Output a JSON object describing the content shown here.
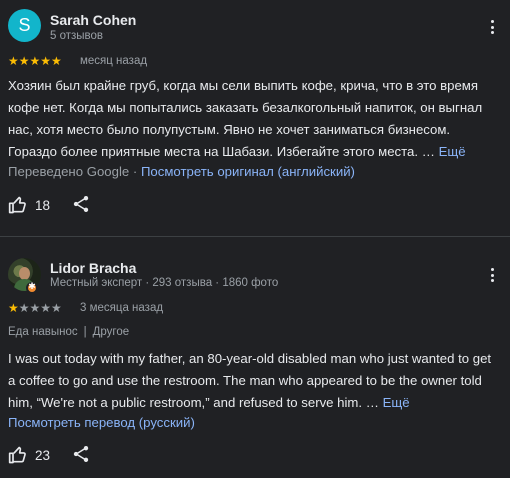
{
  "reviews": [
    {
      "avatar_letter": "S",
      "name": "Sarah Cohen",
      "meta": "5 отзывов",
      "rating": 5,
      "stars_filled": "★★★★★",
      "stars_empty": "",
      "when": "месяц назад",
      "text": "Хозяин был крайне груб, когда мы сели выпить кофе, крича, что в это время кофе нет. Когда мы попытались заказать безалкогольный напиток, он выгнал нас, хотя место было полупустым. Явно не хочет заниматься бизнесом. Гораздо более приятные места на Шабази. Избегайте этого места. …",
      "more": "Ещё",
      "translated_prefix": "Переведено Google ·",
      "translated_link": "Посмотреть оригинал (английский)",
      "likes": "18",
      "icons": {
        "like": "thumbs-up-icon",
        "share": "share-icon",
        "menu": "more-vert-icon"
      }
    },
    {
      "name": "Lidor Bracha",
      "meta": "Местный эксперт · 293 отзыва · 1860 фото",
      "rating": 1,
      "stars_filled": "★",
      "stars_empty": "★★★★",
      "when": "3 месяца назад",
      "tags": [
        "Еда навынос",
        "Другое"
      ],
      "tag_separator": "|",
      "text": "I was out today with my father, an 80-year-old disabled man who just wanted to get a coffee to go and use the restroom. The man who appeared to be the owner told him, “We're not a public restroom,” and refused to serve him. …",
      "more": "Ещё",
      "translate_link": "Посмотреть перевод (русский)",
      "likes": "23",
      "icons": {
        "like": "thumbs-up-icon",
        "share": "share-icon",
        "menu": "more-vert-icon",
        "badge": "local-guide-badge-icon"
      }
    }
  ],
  "colors": {
    "background": "#202124",
    "star": "#fbbc04",
    "link": "#8ab4f8",
    "muted": "#9aa0a6"
  }
}
